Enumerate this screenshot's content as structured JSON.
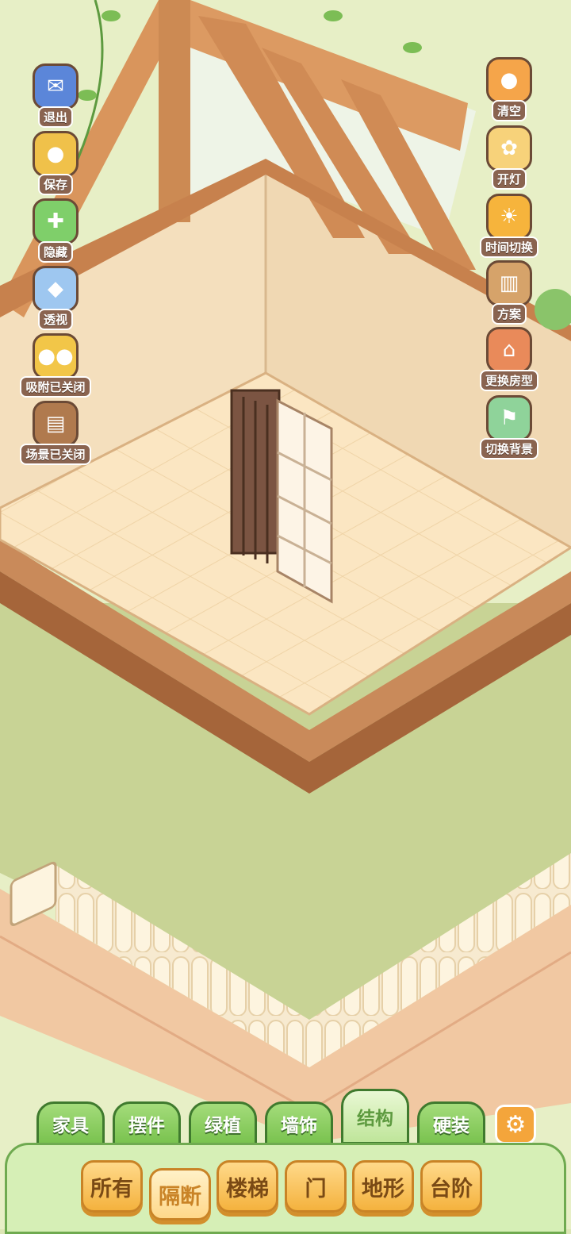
{
  "left_buttons": [
    {
      "label": "退出",
      "icon": "exit-mailbox-icon",
      "color": "#5b86d9"
    },
    {
      "label": "保存",
      "icon": "save-chick-icon",
      "color": "#f0c14a"
    },
    {
      "label": "隐藏",
      "icon": "hide-puzzle-icon",
      "color": "#7fcf6a"
    },
    {
      "label": "透视",
      "icon": "perspective-cube-icon",
      "color": "#9ec7f0"
    },
    {
      "label": "吸附已关闭",
      "icon": "snap-chicks-icon",
      "color": "#f2c648"
    },
    {
      "label": "场景已关闭",
      "icon": "scene-crate-icon",
      "color": "#b07a4e"
    }
  ],
  "right_buttons": [
    {
      "label": "清空",
      "icon": "clear-chick-icon",
      "color": "#f5a54a"
    },
    {
      "label": "开灯",
      "icon": "light-bow-icon",
      "color": "#f7d27a"
    },
    {
      "label": "时间切换",
      "icon": "sun-moon-icon",
      "color": "#f6b43c"
    },
    {
      "label": "方案",
      "icon": "plan-panels-icon",
      "color": "#d6a36a"
    },
    {
      "label": "更换房型",
      "icon": "house-icon",
      "color": "#e98a5a"
    },
    {
      "label": "切换背景",
      "icon": "background-flag-icon",
      "color": "#8fd39a"
    }
  ],
  "tabs": [
    {
      "label": "家具"
    },
    {
      "label": "摆件"
    },
    {
      "label": "绿植"
    },
    {
      "label": "墙饰"
    },
    {
      "label": "结构",
      "active": true
    },
    {
      "label": "硬装"
    }
  ],
  "settings_icon": "gear-icon",
  "subcategories": [
    {
      "label": "所有"
    },
    {
      "label": "隔断",
      "active": true
    },
    {
      "label": "楼梯"
    },
    {
      "label": "门"
    },
    {
      "label": "地形"
    },
    {
      "label": "台阶"
    }
  ]
}
